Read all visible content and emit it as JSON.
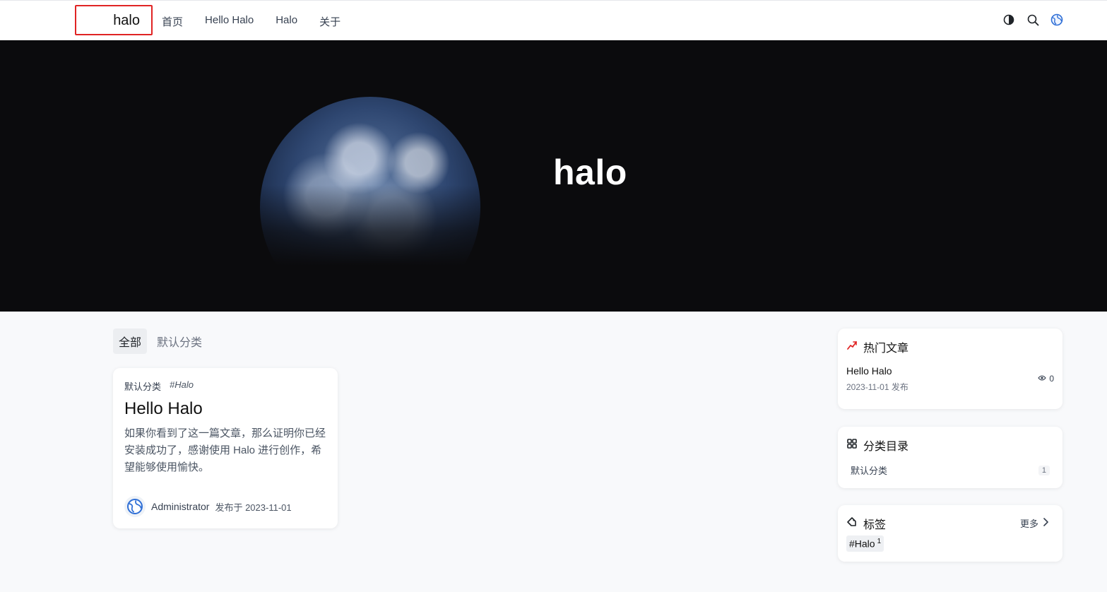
{
  "header": {
    "site_name": "halo",
    "nav": [
      "首页",
      "Hello Halo",
      "Halo",
      "关于"
    ],
    "icons": [
      "theme-toggle-icon",
      "search-icon",
      "globe-icon"
    ]
  },
  "hero": {
    "title": "halo"
  },
  "tabs": [
    {
      "label": "全部",
      "active": true
    },
    {
      "label": "默认分类",
      "active": false
    }
  ],
  "post": {
    "category": "默认分类",
    "tag": "#Halo",
    "title": "Hello Halo",
    "excerpt": "如果你看到了这一篇文章，那么证明你已经安装成功了，感谢使用 Halo 进行创作，希望能够使用愉快。",
    "author": "Administrator",
    "date_text": "发布于 2023-11-01"
  },
  "sidebar": {
    "hot": {
      "title": "热门文章",
      "items": [
        {
          "title": "Hello Halo",
          "date": "2023-11-01 发布",
          "views": "0"
        }
      ]
    },
    "categories": {
      "title": "分类目录",
      "items": [
        {
          "name": "默认分类",
          "count": "1"
        }
      ]
    },
    "tags": {
      "title": "标签",
      "more": "更多",
      "items": [
        {
          "name": "#Halo",
          "count": "1"
        }
      ]
    }
  },
  "colors": {
    "accent_red": "#e02424",
    "hero_bg": "#0b0b0d",
    "page_bg": "#f8f9fb"
  }
}
